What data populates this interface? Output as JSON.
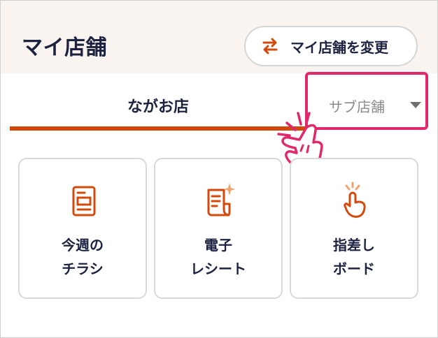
{
  "header": {
    "title": "マイ店舗",
    "change_button": {
      "label": "マイ店舗を変更",
      "icon": "swap-arrows-icon"
    }
  },
  "tabs": [
    {
      "label": "ながお店",
      "selected": true
    },
    {
      "label": "サブ店舗",
      "selected": false,
      "icon": "caret-down-icon"
    }
  ],
  "cards": [
    {
      "line1": "今週の",
      "line2": "チラシ",
      "icon": "flyer-document-icon"
    },
    {
      "line1": "電子",
      "line2": "レシート",
      "icon": "e-receipt-icon"
    },
    {
      "line1": "指差し",
      "line2": "ボード",
      "icon": "pointing-finger-icon"
    }
  ],
  "colors": {
    "accent": "#d2490b",
    "highlight": "#e0286b",
    "header_bg": "#f9f4ef",
    "text": "#1c2240"
  }
}
